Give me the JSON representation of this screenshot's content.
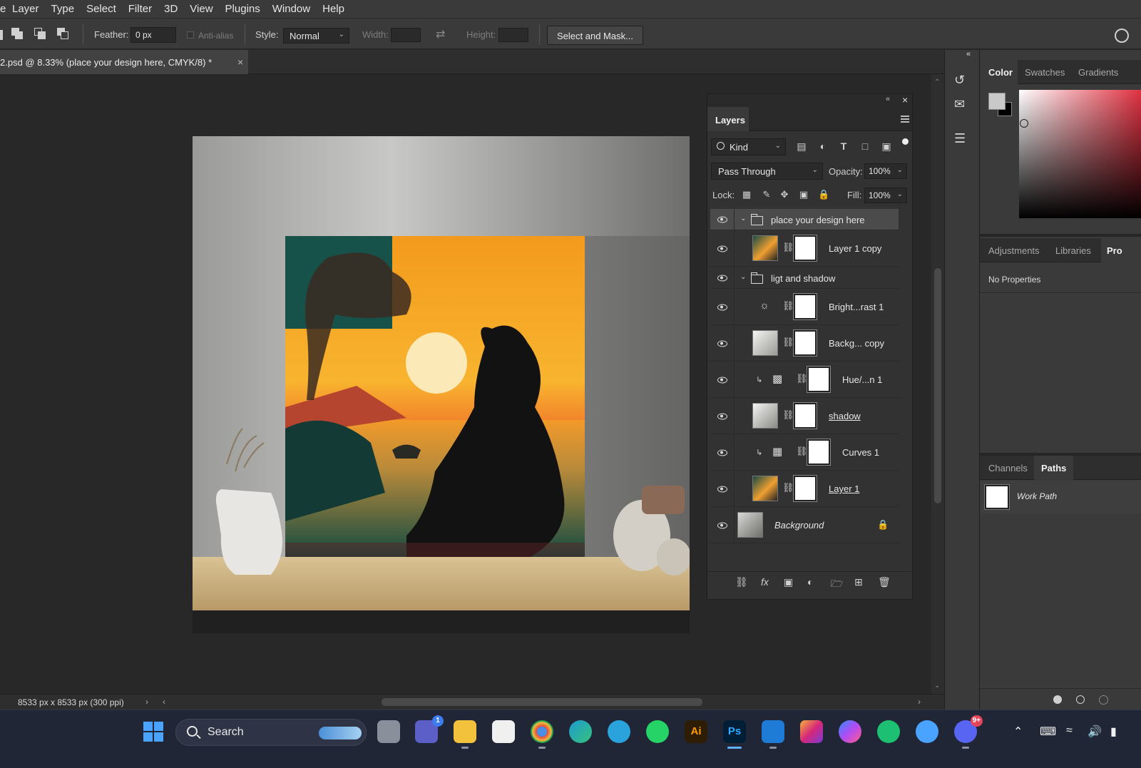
{
  "menu": {
    "items": [
      "e",
      "Layer",
      "Type",
      "Select",
      "Filter",
      "3D",
      "View",
      "Plugins",
      "Window",
      "Help"
    ]
  },
  "options": {
    "feather_label": "Feather:",
    "feather_value": "0 px",
    "antialias_label": "Anti-alias",
    "style_label": "Style:",
    "style_value": "Normal",
    "width_label": "Width:",
    "height_label": "Height:",
    "select_mask_button": "Select and Mask..."
  },
  "document": {
    "tab_title": "2.psd @ 8.33% (place your design here, CMYK/8) *",
    "status_info": "8533 px x 8533 px (300 ppi)"
  },
  "layers_panel": {
    "tab_label": "Layers",
    "filter_kind": "Kind",
    "blend_mode": "Pass Through",
    "opacity_label": "Opacity:",
    "opacity_value": "100%",
    "lock_label": "Lock:",
    "fill_label": "Fill:",
    "fill_value": "100%",
    "layers": [
      {
        "name": "place your design here",
        "type": "group",
        "selected": true
      },
      {
        "name": "Layer 1 copy",
        "type": "smart",
        "indent": 1
      },
      {
        "name": "ligt and shadow",
        "type": "group"
      },
      {
        "name": "Bright...rast 1",
        "type": "adjustment",
        "icon": "sun-icon",
        "indent": 1
      },
      {
        "name": "Backg... copy",
        "type": "pixel",
        "indent": 1
      },
      {
        "name": "Hue/...n 1",
        "type": "adjustment",
        "icon": "hue-saturation-icon",
        "clipped": true
      },
      {
        "name": "shadow",
        "type": "pixel",
        "indent": 1
      },
      {
        "name": "Curves 1",
        "type": "adjustment",
        "icon": "curves-icon",
        "clipped": true
      },
      {
        "name": "Layer 1",
        "type": "smart",
        "indent": 1
      },
      {
        "name": "Background",
        "type": "background",
        "locked": true
      }
    ]
  },
  "right_panels": {
    "color_tabs": [
      "Color",
      "Swatches",
      "Gradients"
    ],
    "properties_tabs": [
      "Adjustments",
      "Libraries",
      "Pro"
    ],
    "properties_text": "No Properties",
    "paths_tabs": [
      "Channels",
      "Paths"
    ],
    "paths_items": [
      "Work Path"
    ]
  },
  "taskbar": {
    "search_placeholder": "Search",
    "apps": [
      {
        "name": "windows-start",
        "color": "#3a8ef6"
      },
      {
        "name": "task-view",
        "color": "#888888"
      },
      {
        "name": "teams-chat",
        "color": "#5b5fc7",
        "badge": "1"
      },
      {
        "name": "file-explorer",
        "color": "#f2c23d"
      },
      {
        "name": "microsoft-store",
        "color": "#ffffff"
      },
      {
        "name": "chrome",
        "color": "#e24b3b"
      },
      {
        "name": "edge",
        "color": "#1d9bd1"
      },
      {
        "name": "telegram",
        "color": "#2aa3dc"
      },
      {
        "name": "whatsapp",
        "color": "#25d366"
      },
      {
        "name": "illustrator",
        "label": "Ai",
        "color": "#2e1d05",
        "fg": "#ff9a00"
      },
      {
        "name": "photoshop",
        "label": "Ps",
        "color": "#001e36",
        "fg": "#31a8ff"
      },
      {
        "name": "remote-app",
        "color": "#1e7cd6"
      },
      {
        "name": "instagram",
        "color": "#d6287a"
      },
      {
        "name": "messenger",
        "color": "#7a5cf5"
      },
      {
        "name": "fiverr-app",
        "color": "#1dbf73"
      },
      {
        "name": "lens-app",
        "color": "#4aa3ff"
      },
      {
        "name": "discord",
        "color": "#5865f2",
        "badge": "9+"
      }
    ]
  },
  "colors": {
    "accent": "#31a8ff",
    "panel": "#323232",
    "background": "#282828"
  }
}
